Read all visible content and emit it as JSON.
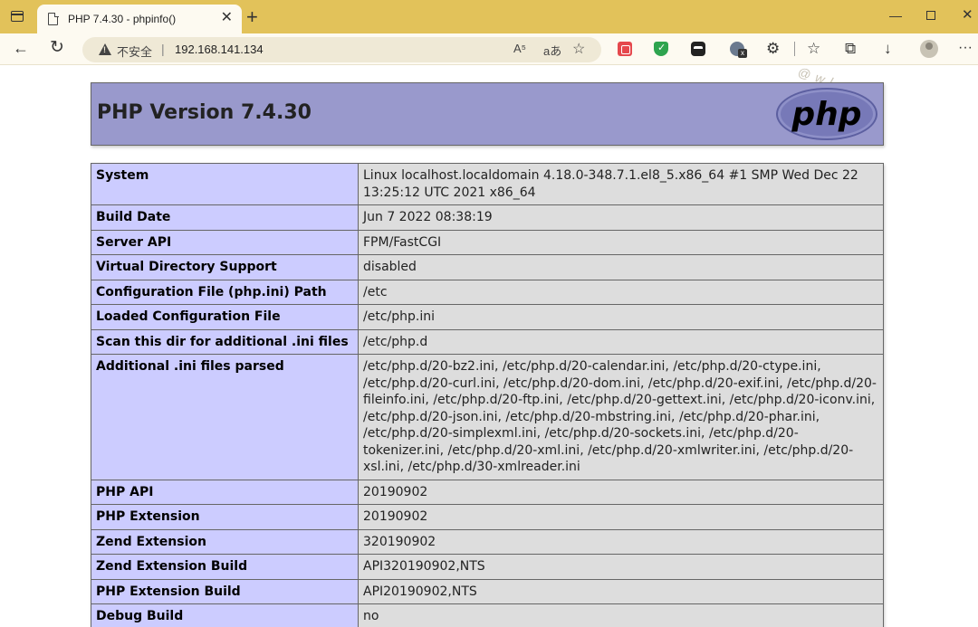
{
  "browser": {
    "tab_title": "PHP 7.4.30 - phpinfo()",
    "tab_close": "✕",
    "new_tab": "+",
    "security_label": "不安全",
    "url": "192.168.141.134",
    "read_aloud": "A⁵",
    "translate": "aあ",
    "watermark": "@wlsmz",
    "window_controls": {
      "minimize": "—",
      "close": "✕"
    }
  },
  "page": {
    "title": "PHP Version 7.4.30",
    "logo_text": "php",
    "rows": [
      {
        "label": "System",
        "value": "Linux localhost.localdomain 4.18.0-348.7.1.el8_5.x86_64 #1 SMP Wed Dec 22 13:25:12 UTC 2021 x86_64"
      },
      {
        "label": "Build Date",
        "value": "Jun 7 2022 08:38:19"
      },
      {
        "label": "Server API",
        "value": "FPM/FastCGI"
      },
      {
        "label": "Virtual Directory Support",
        "value": "disabled"
      },
      {
        "label": "Configuration File (php.ini) Path",
        "value": "/etc"
      },
      {
        "label": "Loaded Configuration File",
        "value": "/etc/php.ini"
      },
      {
        "label": "Scan this dir for additional .ini files",
        "value": "/etc/php.d"
      },
      {
        "label": "Additional .ini files parsed",
        "value": "/etc/php.d/20-bz2.ini, /etc/php.d/20-calendar.ini, /etc/php.d/20-ctype.ini, /etc/php.d/20-curl.ini, /etc/php.d/20-dom.ini, /etc/php.d/20-exif.ini, /etc/php.d/20-fileinfo.ini, /etc/php.d/20-ftp.ini, /etc/php.d/20-gettext.ini, /etc/php.d/20-iconv.ini, /etc/php.d/20-json.ini, /etc/php.d/20-mbstring.ini, /etc/php.d/20-phar.ini, /etc/php.d/20-simplexml.ini, /etc/php.d/20-sockets.ini, /etc/php.d/20-tokenizer.ini, /etc/php.d/20-xml.ini, /etc/php.d/20-xmlwriter.ini, /etc/php.d/20-xsl.ini, /etc/php.d/30-xmlreader.ini"
      },
      {
        "label": "PHP API",
        "value": "20190902"
      },
      {
        "label": "PHP Extension",
        "value": "20190902"
      },
      {
        "label": "Zend Extension",
        "value": "320190902"
      },
      {
        "label": "Zend Extension Build",
        "value": "API320190902,NTS"
      },
      {
        "label": "PHP Extension Build",
        "value": "API20190902,NTS"
      },
      {
        "label": "Debug Build",
        "value": "no"
      }
    ]
  },
  "colors": {
    "tabbar": "#e2c25a",
    "header_bg": "#9999cc",
    "label_cell_bg": "#ccccff",
    "value_cell_bg": "#dddddd"
  },
  "icons": [
    "window-icon",
    "page-icon",
    "back-icon",
    "reload-icon",
    "warning-icon",
    "read-aloud-icon",
    "translate-icon",
    "add-favorite-icon",
    "extension-icon",
    "puzzle-icon",
    "favorites-icon",
    "collections-icon",
    "download-icon",
    "profile-icon",
    "more-icon"
  ]
}
